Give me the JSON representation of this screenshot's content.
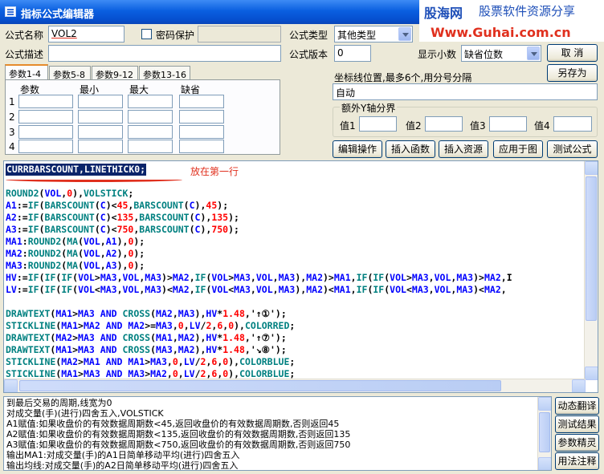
{
  "window": {
    "title": "指标公式编辑器"
  },
  "brand": {
    "logo": "股海网",
    "subtitle": "股票软件资源分享",
    "url": "Www.Guhai.com.cn"
  },
  "form": {
    "name_label": "公式名称",
    "name_value": "VOL2",
    "password_label": "密码保护",
    "password_checked": false,
    "type_label": "公式类型",
    "type_value": "其他类型",
    "desc_label": "公式描述",
    "desc_value": "",
    "version_label": "公式版本",
    "version_value": "0",
    "decimals_label": "显示小数",
    "decimals_value": "缺省位数"
  },
  "buttons": {
    "confirm": "确 定",
    "cancel": "取 消",
    "save_as": "另存为",
    "edit": "编辑操作",
    "insert_func": "插入函数",
    "insert_res": "插入资源",
    "apply": "应用于图",
    "test": "测试公式",
    "dyn_translate": "动态翻译",
    "test_result": "测试结果",
    "param_tune": "参数精灵",
    "usage_note": "用法注释"
  },
  "tabs": [
    "参数1-4",
    "参数5-8",
    "参数9-12",
    "参数13-16"
  ],
  "param_table": {
    "headers": [
      "参数",
      "最小",
      "最大",
      "缺省"
    ],
    "rows": [
      "1",
      "2",
      "3",
      "4"
    ]
  },
  "axis": {
    "label": "坐标线位置,最多6个,用分号分隔",
    "value": "自动",
    "extra_label": "额外Y轴分界",
    "values": [
      "值1",
      "值2",
      "值3",
      "值4"
    ]
  },
  "editor": {
    "first_line": "CURRBARSCOUNT,LINETHICK0;",
    "note": "放在第一行",
    "lines": [
      "ROUND2(VOL,0),VOLSTICK;",
      "A1:=IF(BARSCOUNT(C)<45,BARSCOUNT(C),45);",
      "A2:=IF(BARSCOUNT(C)<135,BARSCOUNT(C),135);",
      "A3:=IF(BARSCOUNT(C)<750,BARSCOUNT(C),750);",
      "MA1:ROUND2(MA(VOL,A1),0);",
      "MA2:ROUND2(MA(VOL,A2),0);",
      "MA3:ROUND2(MA(VOL,A3),0);",
      "HV:=IF(IF(IF(VOL>MA3,VOL,MA3)>MA2,IF(VOL>MA3,VOL,MA3),MA2)>MA1,IF(IF(VOL>MA3,VOL,MA3)>MA2,I",
      "LV:=IF(IF(IF(VOL<MA3,VOL,MA3)<MA2,IF(VOL<MA3,VOL,MA3),MA2)<MA1,IF(IF(VOL<MA3,VOL,MA3)<MA2,",
      "",
      "DRAWTEXT(MA1>MA3 AND CROSS(MA2,MA3),HV*1.48,'↑①');",
      "STICKLINE(MA1>MA2 AND MA2>=MA3,0,LV/2,6,0),COLORRED;",
      "DRAWTEXT(MA2>MA3 AND CROSS(MA1,MA2),HV*1.48,'↑⑦');",
      "DRAWTEXT(MA1>MA3 AND CROSS(MA3,MA2),HV*1.48,'↘⑧');",
      "STICKLINE(MA2>MA1 AND MA1>MA3,0,LV/2,6,0),COLORBLUE;",
      "STICKLINE(MA1>MA3 AND MA3>MA2,0,LV/2,6,0),COLORBLUE;"
    ]
  },
  "explain": {
    "lines": [
      "到最后交易的周期,线宽为0",
      "对成交量(手)(进行)四舍五入,VOLSTICK",
      "A1赋值:如果收盘价的有效数据周期数<45,返回收盘价的有效数据周期数,否则返回45",
      "A2赋值:如果收盘价的有效数据周期数<135,返回收盘价的有效数据周期数,否则返回135",
      "A3赋值:如果收盘价的有效数据周期数<750,返回收盘价的有效数据周期数,否则返回750",
      "输出MA1:对成交量(手)的A1日简单移动平均(进行)四舍五入",
      "输出均线:对成交量(手)的A2日简单移动平均(进行)四舍五入"
    ]
  },
  "colors": {
    "keyword_blue": "#0000ff",
    "function_teal": "#008080",
    "number_red": "#ff0000",
    "highlight_bg": "#0a246a",
    "note_red": "#e0301e"
  }
}
